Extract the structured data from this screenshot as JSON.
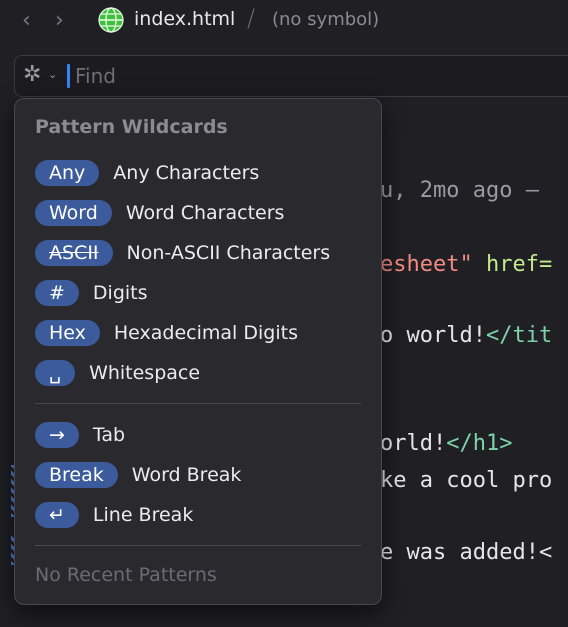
{
  "header": {
    "back_label": "‹",
    "forward_label": "›",
    "file_icon": "globe-icon",
    "filename": "index.html",
    "separator": "/",
    "symbol": "(no symbol)"
  },
  "find": {
    "mode_icon": "asterisk-icon",
    "placeholder": "Find",
    "value": ""
  },
  "code": {
    "line1": "u, 2mo ago –",
    "line2_str": "esheet\"",
    "line2_attr": " href=",
    "line3_text": "o world!",
    "line3_tag": "</tit",
    "line4_text": "orld!",
    "line4_tag": "</h1>",
    "line5_text": "ke a cool pro",
    "line6_text": "e was added!<"
  },
  "popup": {
    "title": "Pattern Wildcards",
    "group1": [
      {
        "token": "Any",
        "label": "Any Characters"
      },
      {
        "token": "Word",
        "label": "Word Characters"
      },
      {
        "token": "ASCII",
        "label": "Non-ASCII Characters"
      },
      {
        "token": "#",
        "label": "Digits"
      },
      {
        "token": "Hex",
        "label": "Hexadecimal Digits"
      },
      {
        "token": "␣",
        "label": "Whitespace"
      }
    ],
    "group2": [
      {
        "token": "→",
        "label": "Tab"
      },
      {
        "token": "Break",
        "label": "Word Break"
      },
      {
        "token": "↵",
        "label": "Line Break"
      }
    ],
    "recent": "No Recent Patterns"
  },
  "colors": {
    "pill": "#3b5b9d",
    "background": "#1f1f24",
    "popup": "#29292e",
    "cursor": "#3a82f7"
  }
}
